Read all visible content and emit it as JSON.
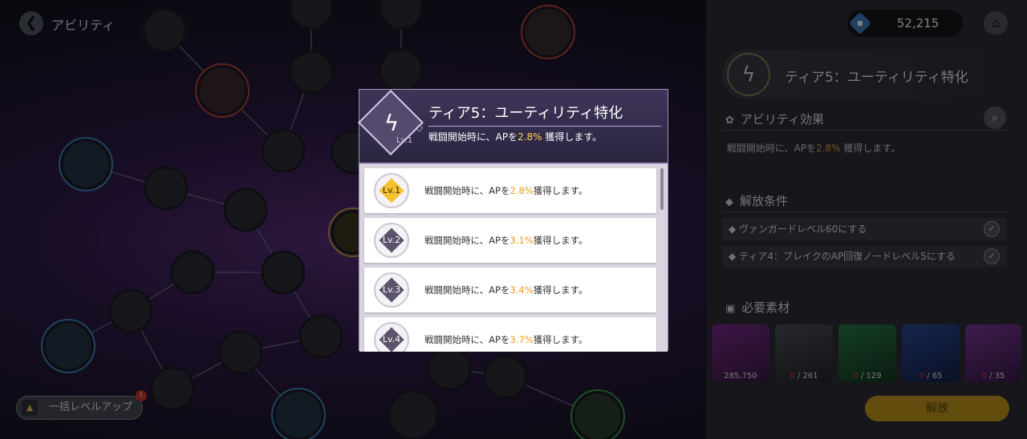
{
  "topbar": {
    "title": "アビリティ"
  },
  "currency": {
    "amount": "52,215"
  },
  "panel": {
    "title": "ティア5：ユーティリティ特化",
    "effect_title": "アビリティ効果",
    "effect_desc_pre": "戦闘開始時に、APを",
    "effect_value": "2.8%",
    "effect_desc_post": " 獲得します。",
    "unlock_title": "解放条件",
    "conditions": [
      "ヴァンガードレベル60にする",
      "ティア4：ブレイクのAP回復ノードレベル5にする"
    ],
    "materials_title": "必要素材",
    "materials": [
      {
        "have": "285,750",
        "need": ""
      },
      {
        "have": "0",
        "need": "261"
      },
      {
        "have": "0",
        "need": "129"
      },
      {
        "have": "0",
        "need": "65"
      },
      {
        "have": "0",
        "need": "35"
      }
    ],
    "unlock_button": "解放"
  },
  "bulk": {
    "label": "一括レベルアップ",
    "badge": "!"
  },
  "modal": {
    "title": "ティア5：ユーティリティ特化",
    "level": "Lv.1",
    "desc_pre": "戦闘開始時に、APを",
    "desc_value": "2.8%",
    "desc_post": " 獲得します。",
    "levels": [
      {
        "label": "Lv.1",
        "pre": "戦闘開始時に、APを",
        "value": "2.8%",
        "post": "獲得します。"
      },
      {
        "label": "Lv.2",
        "pre": "戦闘開始時に、APを",
        "value": "3.1%",
        "post": "獲得します。"
      },
      {
        "label": "Lv.3",
        "pre": "戦闘開始時に、APを",
        "value": "3.4%",
        "post": "獲得します。"
      },
      {
        "label": "Lv.4",
        "pre": "戦闘開始時に、APを",
        "value": "3.7%",
        "post": "獲得します。"
      }
    ]
  },
  "colors": {
    "accent": "#f2a640",
    "modal_accent": "#ffd65a",
    "active_badge": "#f6c230"
  },
  "icons": {
    "back": "arrow-left-icon",
    "home": "home-icon",
    "search": "search-icon",
    "ability": "lightning-icon"
  }
}
